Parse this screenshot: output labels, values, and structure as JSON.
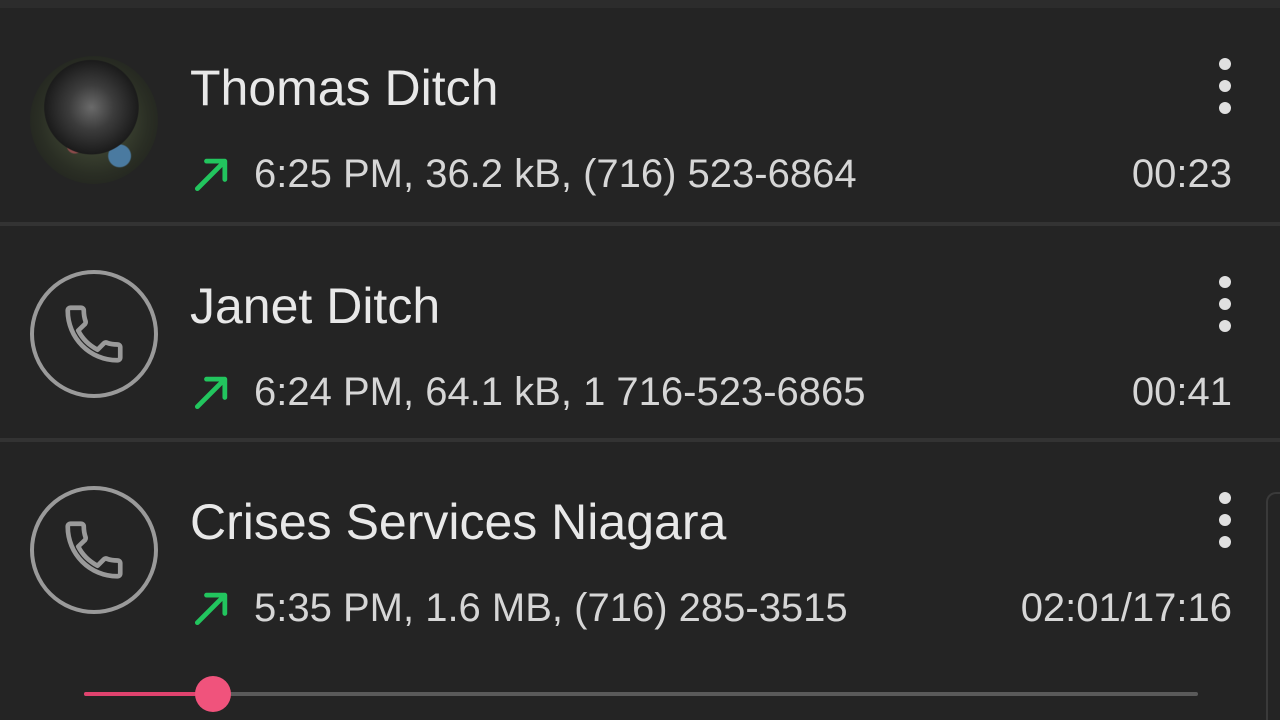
{
  "calls": [
    {
      "name": "Thomas Ditch",
      "avatar_icon": "contact-photo",
      "direction_icon": "outgoing-arrow-icon",
      "details": "6:25 PM, 36.2 kB, (716) 523-6864",
      "duration": "00:23"
    },
    {
      "name": "Janet Ditch",
      "avatar_icon": "phone-icon",
      "direction_icon": "outgoing-arrow-icon",
      "details": "6:24 PM, 64.1 kB, 1 716-523-6865",
      "duration": "00:41"
    },
    {
      "name": "Crises Services Niagara",
      "avatar_icon": "phone-icon",
      "direction_icon": "outgoing-arrow-icon",
      "details": "5:35 PM, 1.6 MB, (716) 285-3515",
      "duration": "02:01/17:16",
      "playback_progress": 0.116
    }
  ],
  "colors": {
    "background": "#242424",
    "outgoing_arrow": "#22c55e",
    "seek_accent": "#e0436e",
    "text": "#e6e6e6"
  }
}
